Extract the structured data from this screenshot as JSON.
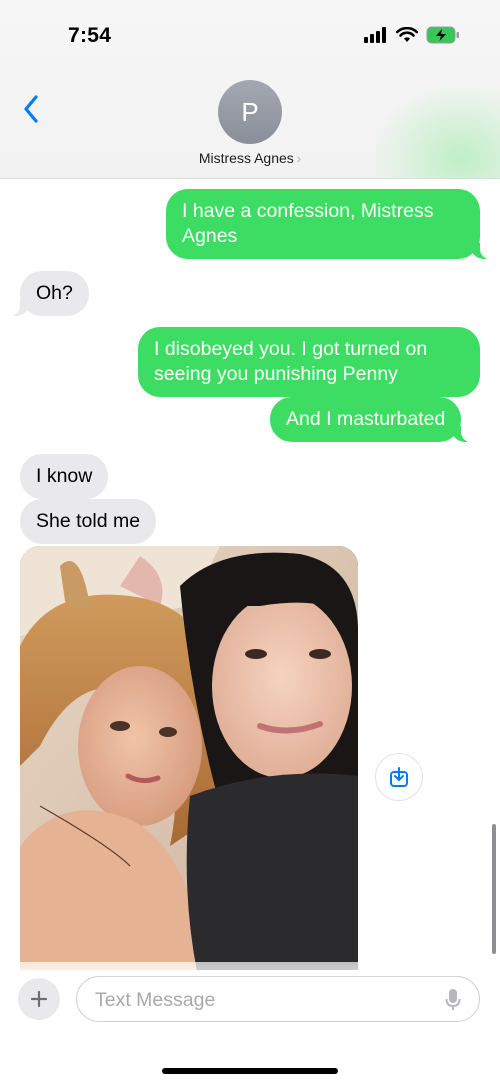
{
  "status_bar": {
    "time": "7:54"
  },
  "header": {
    "avatar_initial": "P",
    "contact_name": "Mistress Agnes",
    "chevron": "›"
  },
  "messages": [
    {
      "from": "me",
      "text": "I have a confession, Mistress Agnes"
    },
    {
      "from": "them",
      "text": "Oh?"
    },
    {
      "from": "me",
      "text": "I disobeyed you. I got turned on seeing you punishing Penny"
    },
    {
      "from": "me",
      "text": "And I masturbated"
    },
    {
      "from": "them",
      "text": "I know"
    },
    {
      "from": "them",
      "text": "She told me"
    },
    {
      "from": "them",
      "type": "photo"
    }
  ],
  "composer": {
    "placeholder": "Text Message"
  },
  "colors": {
    "sent": "#3ddc62",
    "received": "#e9e9eb",
    "accent": "#007aff"
  },
  "icons": [
    "back-chevron-icon",
    "signal-icon",
    "wifi-icon",
    "battery-charging-icon",
    "save-icon",
    "plus-icon",
    "microphone-icon"
  ]
}
